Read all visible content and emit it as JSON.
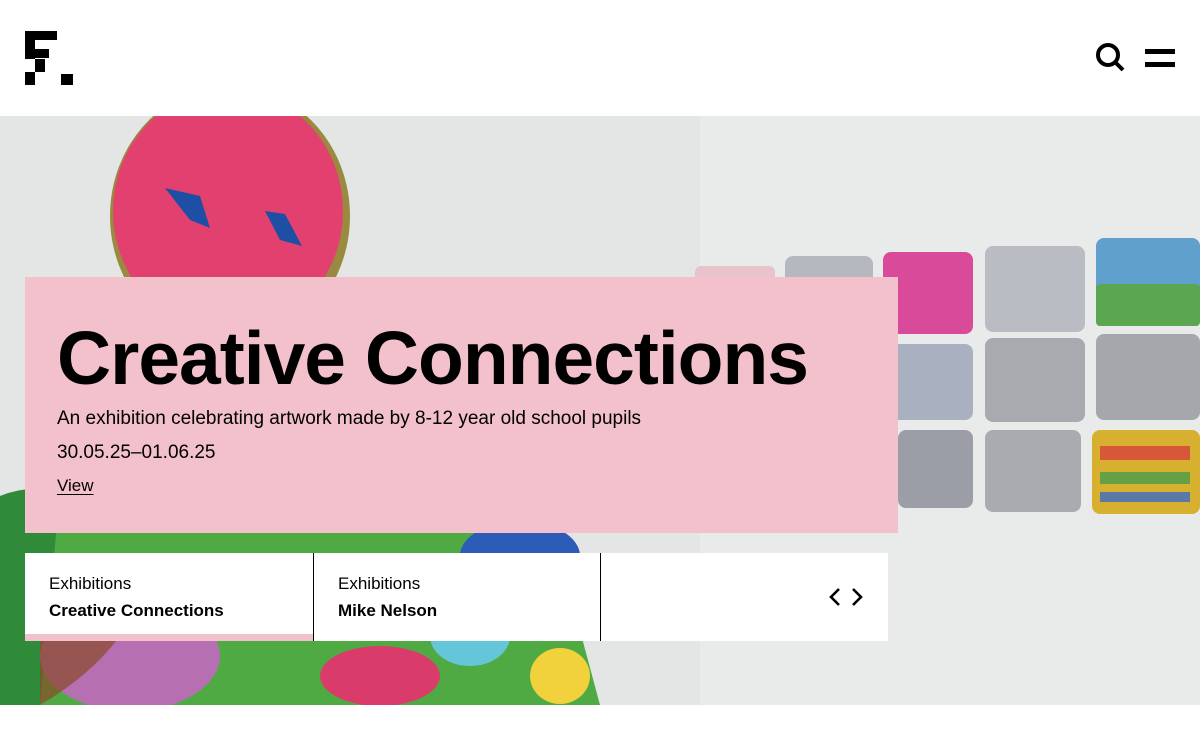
{
  "header": {
    "logo_icon": "fact-logo-icon",
    "search_icon": "search-icon",
    "menu_icon": "hamburger-menu-icon"
  },
  "hero": {
    "title": "Creative Connections",
    "subtitle": "An exhibition celebrating artwork made by 8-12 year old school pupils",
    "dates": "30.05.25–01.06.25",
    "link_label": "View",
    "card_color": "#f3c1cb"
  },
  "carousel": {
    "slides": [
      {
        "category": "Exhibitions",
        "title": "Creative Connections",
        "active": true,
        "progress": 1.0
      },
      {
        "category": "Exhibitions",
        "title": "Mike Nelson",
        "active": false
      }
    ],
    "prev_icon": "chevron-left-icon",
    "next_icon": "chevron-right-icon"
  }
}
